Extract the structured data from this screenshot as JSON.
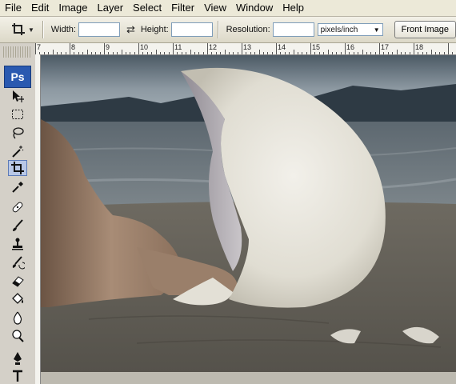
{
  "menu": [
    "File",
    "Edit",
    "Image",
    "Layer",
    "Select",
    "Filter",
    "View",
    "Window",
    "Help"
  ],
  "options": {
    "width_label": "Width:",
    "width_value": "",
    "height_label": "Height:",
    "height_value": "",
    "resolution_label": "Resolution:",
    "resolution_value": "",
    "unit_selected": "pixels/inch",
    "front_image_label": "Front Image"
  },
  "toolbox": {
    "logo": "Ps",
    "tools": [
      "move-tool",
      "marquee-tool",
      "lasso-tool",
      "magic-wand-tool",
      "crop-tool",
      "eyedropper-tool",
      "healing-brush-tool",
      "brush-tool",
      "clone-stamp-tool",
      "history-brush-tool",
      "eraser-tool",
      "paint-bucket-tool",
      "blur-tool",
      "dodge-tool",
      "pen-tool",
      "type-tool"
    ],
    "active_tool": "crop-tool"
  },
  "ruler": {
    "labels": [
      "7",
      "8",
      "9",
      "10",
      "11",
      "12",
      "13",
      "14",
      "15",
      "16",
      "17",
      "18"
    ]
  },
  "colors": {
    "accent": "#2a59b0",
    "menu_bg": "#ece9d8",
    "panel_bg": "#d4d0c8"
  }
}
